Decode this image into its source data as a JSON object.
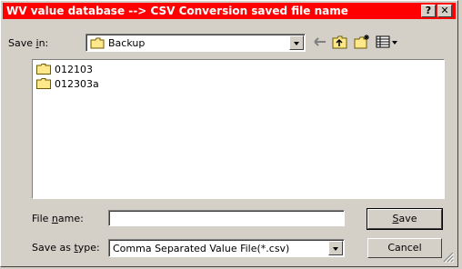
{
  "window": {
    "title": "WV value database --> CSV Conversion saved file name",
    "help_button": "?",
    "close_button": "✕"
  },
  "save_in": {
    "label_prefix": "Save ",
    "label_accel": "i",
    "label_suffix": "n:",
    "folder": "Backup"
  },
  "files": [
    {
      "name": "012103"
    },
    {
      "name": "012303a"
    }
  ],
  "file_name": {
    "label_prefix": "File ",
    "label_accel": "n",
    "label_suffix": "ame:",
    "value": ""
  },
  "save_as_type": {
    "label_prefix": "Save as ",
    "label_accel": "t",
    "label_suffix": "ype:",
    "value": "Comma Separated Value File(*.csv)"
  },
  "buttons": {
    "save_accel": "S",
    "save_suffix": "ave",
    "cancel": "Cancel"
  }
}
